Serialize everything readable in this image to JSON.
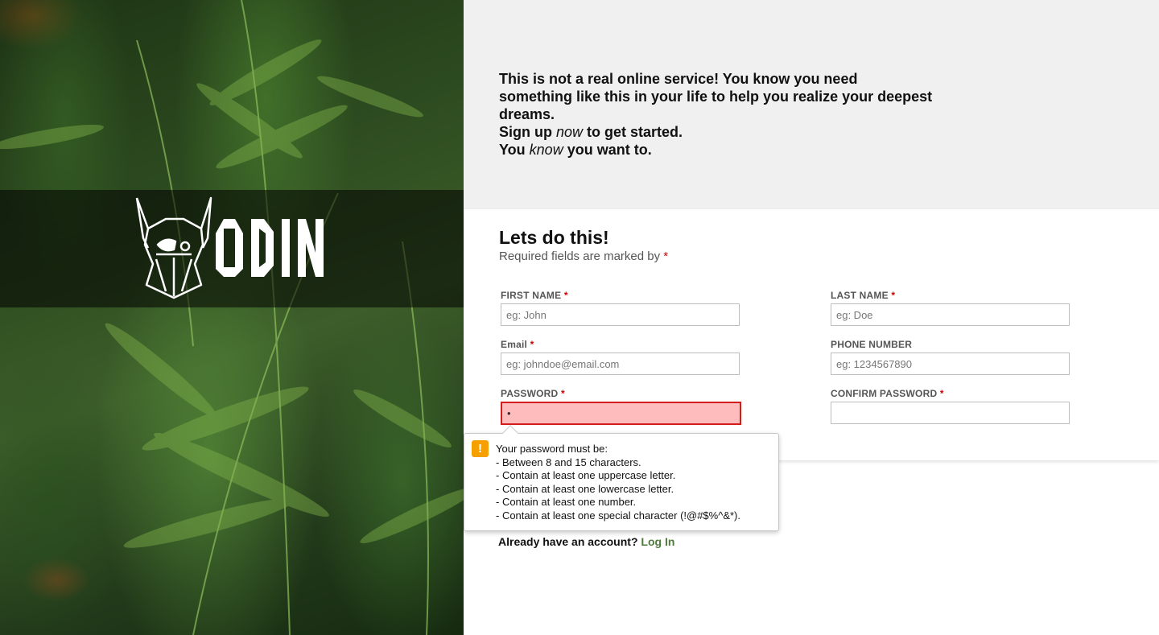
{
  "hero": {
    "logo_text": "ODIN"
  },
  "intro": {
    "line1": "This is not a real online service! You know you need something like this in your life to help you realize your deepest dreams.",
    "line2_pre": "Sign up ",
    "line2_em": "now",
    "line2_post": " to get started.",
    "line3_pre": "You ",
    "line3_em": "know",
    "line3_post": " you want to."
  },
  "form": {
    "title": "Lets do this!",
    "subtitle": "Required fields are marked by ",
    "required_mark": "*",
    "fields": {
      "first_name": {
        "label": "FIRST NAME",
        "required": "*",
        "placeholder": "eg: John",
        "value": ""
      },
      "last_name": {
        "label": "LAST NAME",
        "required": "*",
        "placeholder": "eg: Doe",
        "value": ""
      },
      "email": {
        "label": "Email",
        "required": "*",
        "placeholder": "eg: johndoe@email.com",
        "value": ""
      },
      "phone": {
        "label": "PHONE NUMBER",
        "placeholder": "eg: 1234567890",
        "value": ""
      },
      "password": {
        "label": "PASSWORD",
        "required": "*",
        "value": "•"
      },
      "confirm_password": {
        "label": "CONFIRM PASSWORD",
        "required": "*",
        "value": ""
      }
    }
  },
  "tooltip": {
    "icon": "warning-icon",
    "lines": [
      "Your password must be:",
      "- Between 8 and 15 characters.",
      "- Contain at least one uppercase letter.",
      "- Contain at least one lowercase letter.",
      "- Contain at least one number.",
      "- Contain at least one special character (!@#$%^&*)."
    ]
  },
  "login": {
    "prompt": "Already have an account? ",
    "link": "Log In"
  },
  "colors": {
    "required": "#cc0000",
    "invalid_bg": "#ffbcbc",
    "invalid_border": "#d31c1c",
    "link": "#4e7a3c",
    "warning": "#f5a000"
  }
}
